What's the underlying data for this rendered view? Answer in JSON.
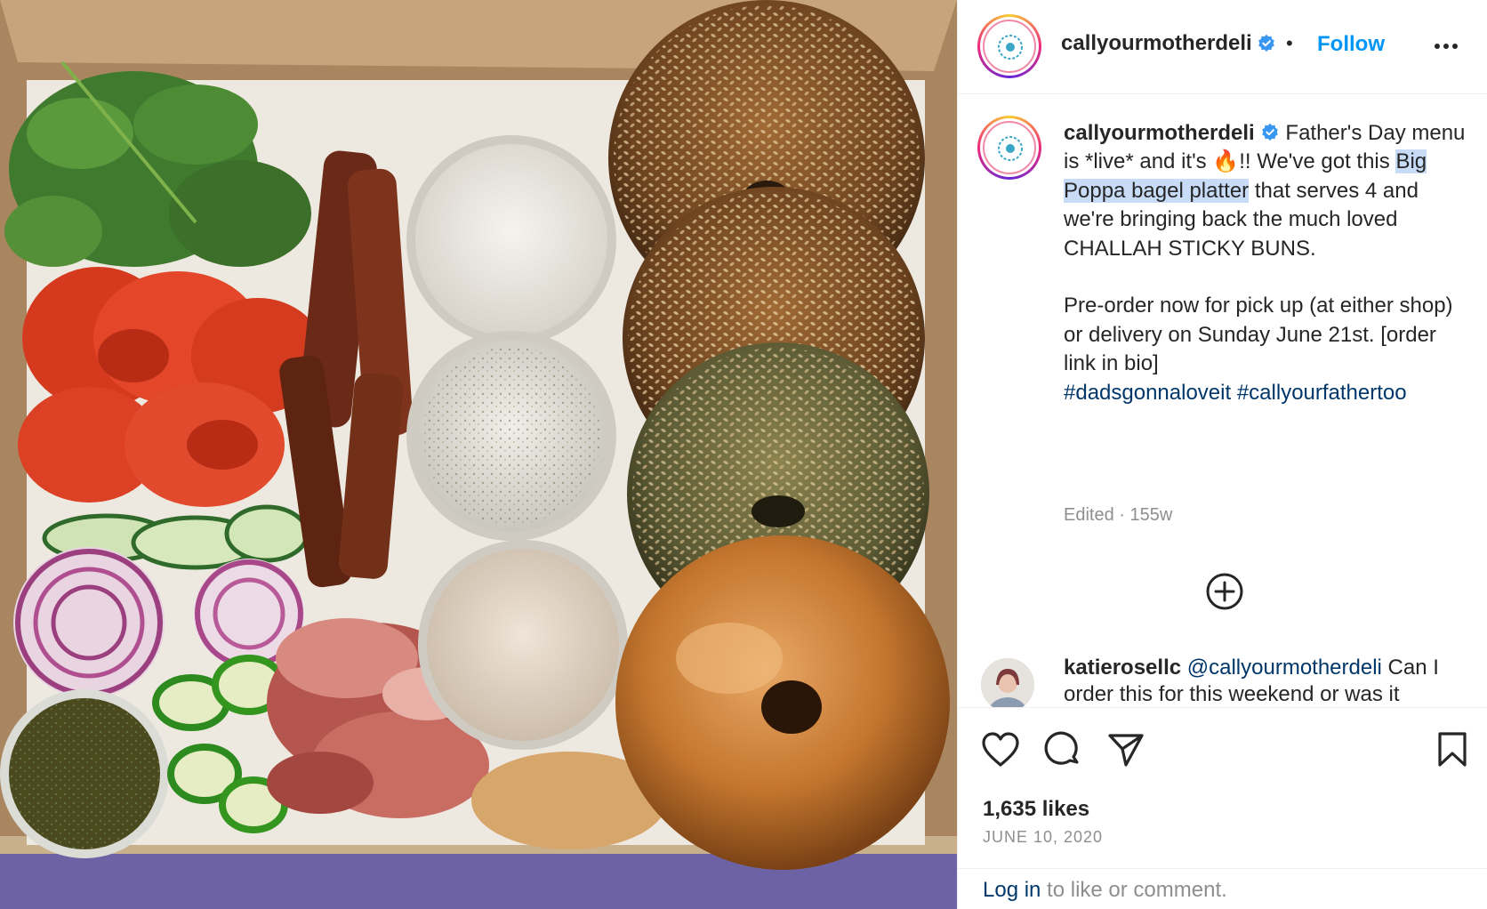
{
  "post": {
    "username": "callyourmotherdeli",
    "follow_label": "Follow",
    "separator": "•",
    "avatar_text": "CALL YOUR MOTHER"
  },
  "caption": {
    "username": "callyourmotherdeli",
    "text_1": " Father's Day menu is *live* and it's ",
    "emoji": "🔥",
    "text_2": "!! We've got this ",
    "highlight": "Big Poppa bagel platter",
    "text_3": " that serves 4 and we're bringing back the much loved CHALLAH STICKY BUNS.",
    "text_4": "Pre-order now for pick up (at either shop) or delivery on Sunday June 21st. [order link in bio]",
    "hashtag_1": "#dadsgonnaloveit",
    "hashtag_2": "#callyourfathertoo",
    "edited": "Edited · 155w"
  },
  "comment": {
    "username": "katierosellc",
    "mention": "@callyourmotherdeli",
    "text": " Can I order this for this weekend or was it"
  },
  "stats": {
    "likes": "1,635 likes",
    "date": "JUNE 10, 2020"
  },
  "login": {
    "link": "Log in",
    "rest": " to like or comment."
  },
  "colors": {
    "link_blue": "#0095f6",
    "dark_link": "#00376b",
    "highlight": "#c8dcf8",
    "muted": "#8e8e8e"
  },
  "icons": [
    "verified-badge-icon",
    "more-options-icon",
    "add-comment-icon",
    "heart-icon",
    "comment-icon",
    "share-icon",
    "bookmark-icon"
  ]
}
